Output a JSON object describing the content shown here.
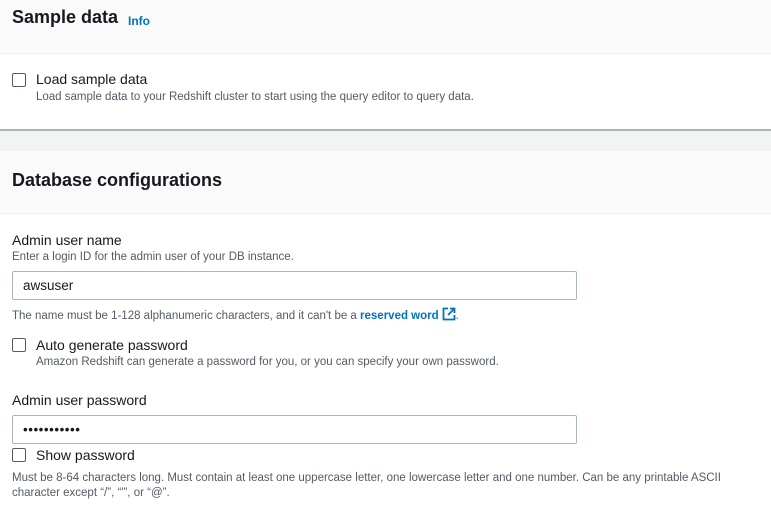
{
  "sample_data": {
    "title": "Sample data",
    "info_label": "Info",
    "load_checkbox": {
      "label": "Load sample data",
      "description": "Load sample data to your Redshift cluster to start using the query editor to query data.",
      "checked": false
    }
  },
  "database_config": {
    "title": "Database configurations",
    "admin_user": {
      "label": "Admin user name",
      "description": "Enter a login ID for the admin user of your DB instance.",
      "value": "awsuser",
      "constraint_prefix": "The name must be 1-128 alphanumeric characters, and it can't be a ",
      "reserved_word_link": "reserved word",
      "constraint_suffix": "."
    },
    "auto_generate": {
      "label": "Auto generate password",
      "description": "Amazon Redshift can generate a password for you, or you can specify your own password.",
      "checked": false
    },
    "admin_password": {
      "label": "Admin user password",
      "value": "•••••••••••",
      "show_password_label": "Show password",
      "show_password_checked": false,
      "constraint": "Must be 8-64 characters long. Must contain at least one uppercase letter, one lowercase letter and one number. Can be any printable ASCII character except “/”, “'”, or “@”."
    }
  },
  "colors": {
    "link": "#0073bb",
    "header_bg": "#fafafa",
    "text": "#16191f",
    "secondary_text": "#545b64"
  },
  "icons": {
    "external_link": "external-link-icon"
  }
}
